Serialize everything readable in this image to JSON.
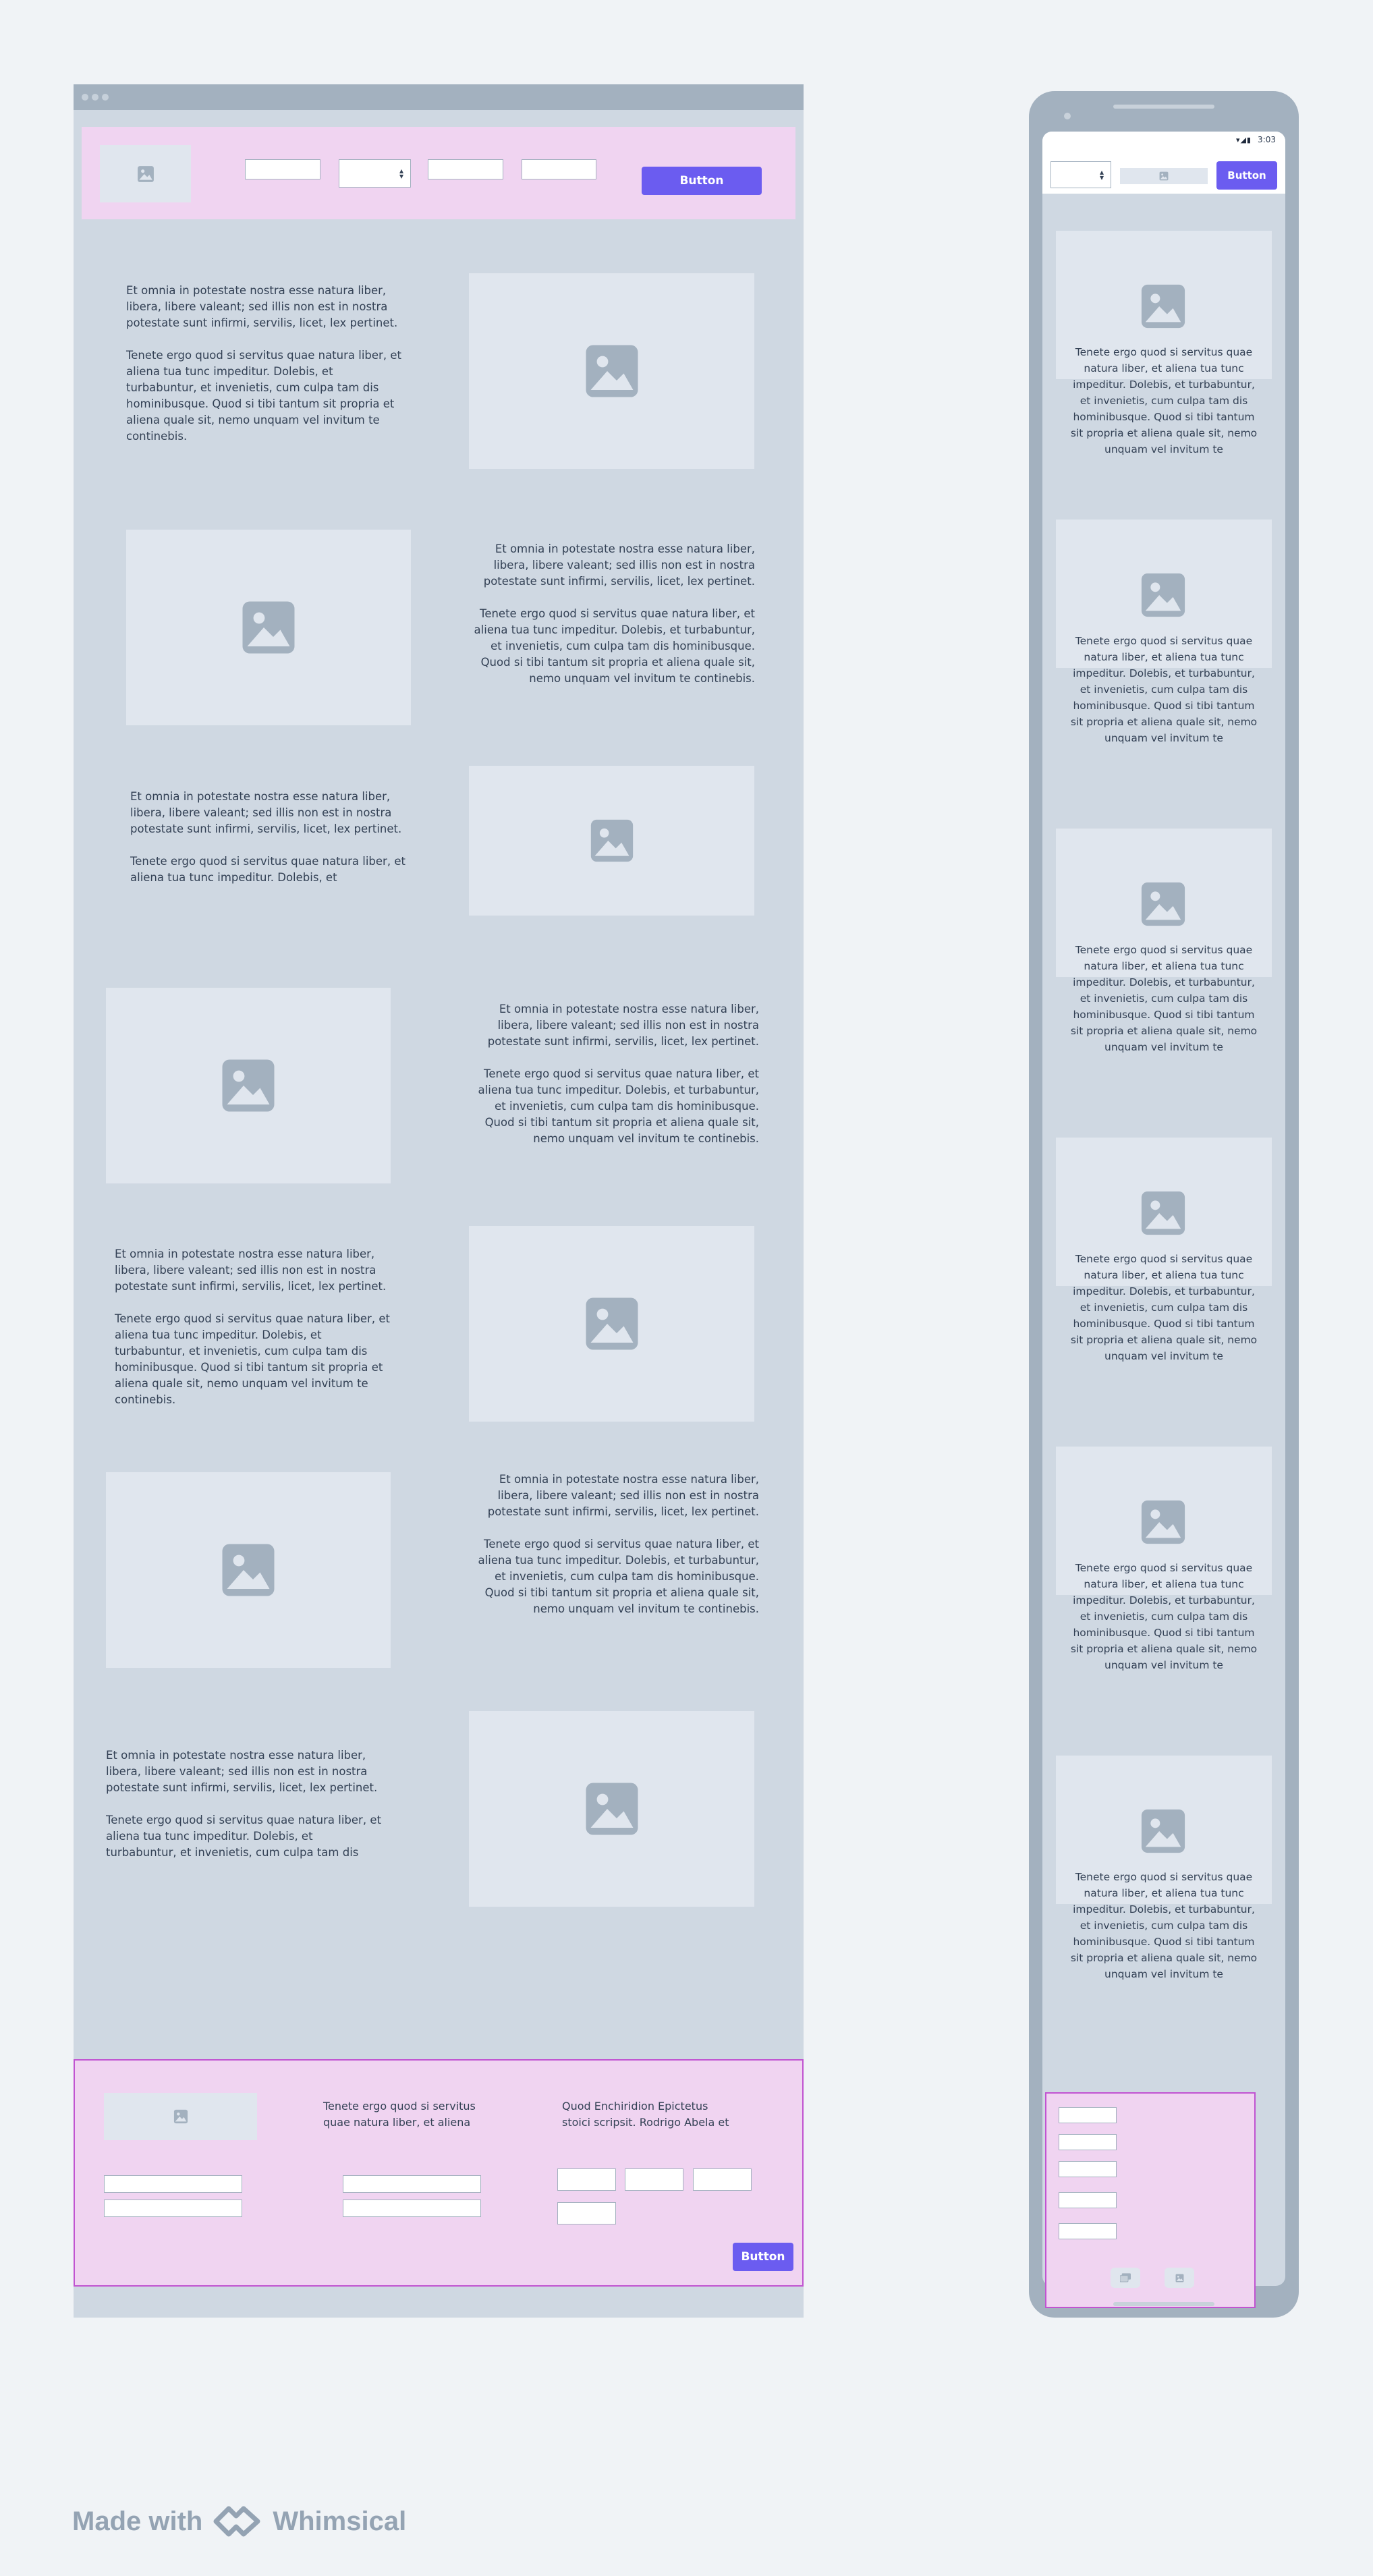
{
  "desktop": {
    "header": {
      "button_label": "Button"
    },
    "sections": [
      {
        "layout": "text-left",
        "paragraph1": "Et omnia in potestate nostra esse natura liber, libera, libere valeant; sed illis non est in nostra potestate sunt infirmi, servilis, licet, lex pertinet.",
        "paragraph2": "Tenete ergo quod si servitus quae natura liber, et aliena tua tunc impeditur. Dolebis, et turbabuntur, et invenietis, cum culpa tam dis hominibusque. Quod si tibi tantum sit propria et aliena quale sit, nemo unquam vel invitum te continebis."
      },
      {
        "layout": "text-right",
        "paragraph1": "Et omnia in potestate nostra esse natura liber, libera, libere valeant; sed illis non est in nostra potestate sunt infirmi, servilis, licet, lex pertinet.",
        "paragraph2": "Tenete ergo quod si servitus quae natura liber, et aliena tua tunc impeditur. Dolebis, et turbabuntur, et invenietis, cum culpa tam dis hominibusque. Quod si tibi tantum sit propria et aliena quale sit, nemo unquam vel invitum te continebis."
      },
      {
        "layout": "text-left",
        "paragraph1": "Et omnia in potestate nostra esse natura liber, libera, libere valeant; sed illis non est in nostra potestate sunt infirmi, servilis, licet, lex pertinet.",
        "paragraph2": "Tenete ergo quod si servitus quae natura liber, et aliena tua tunc impeditur. Dolebis, et turbabuntur, et"
      },
      {
        "layout": "text-right",
        "paragraph1": "Et omnia in potestate nostra esse natura liber, libera, libere valeant; sed illis non est in nostra potestate sunt infirmi, servilis, licet, lex pertinet.",
        "paragraph2": "Tenete ergo quod si servitus quae natura liber, et aliena tua tunc impeditur. Dolebis, et turbabuntur, et invenietis, cum culpa tam dis hominibusque. Quod si tibi tantum sit propria et aliena quale sit, nemo unquam vel invitum te continebis."
      },
      {
        "layout": "text-left",
        "paragraph1": "Et omnia in potestate nostra esse natura liber, libera, libere valeant; sed illis non est in nostra potestate sunt infirmi, servilis, licet, lex pertinet.",
        "paragraph2": "Tenete ergo quod si servitus quae natura liber, et aliena tua tunc impeditur. Dolebis, et turbabuntur, et invenietis, cum culpa tam dis hominibusque. Quod si tibi tantum sit propria et aliena quale sit, nemo unquam vel invitum te continebis."
      },
      {
        "layout": "text-right",
        "paragraph1": "Et omnia in potestate nostra esse natura liber, libera, libere valeant; sed illis non est in nostra potestate sunt infirmi, servilis, licet, lex pertinet.",
        "paragraph2": "Tenete ergo quod si servitus quae natura liber, et aliena tua tunc impeditur. Dolebis, et turbabuntur, et invenietis, cum culpa tam dis hominibusque. Quod si tibi tantum sit propria et aliena quale sit, nemo unquam vel invitum te continebis."
      },
      {
        "layout": "text-left",
        "paragraph1": "Et omnia in potestate nostra esse natura liber, libera, libere valeant; sed illis non est in nostra potestate sunt infirmi, servilis, licet, lex pertinet.",
        "paragraph2": "Tenete ergo quod si servitus quae natura liber, et aliena tua tunc impeditur. Dolebis, et turbabuntur, et invenietis, cum culpa tam dis hominibusque. Quod si"
      }
    ],
    "footer": {
      "text1": "Tenete ergo quod si servitus quae natura liber, et aliena",
      "text2": "Quod Enchiridion Epictetus stoici scripsit. Rodrigo Abela et",
      "button_label": "Button"
    }
  },
  "mobile": {
    "status_time": "3:03",
    "status_icons": "▾◢▮",
    "button_label": "Button",
    "cards": [
      {
        "text": "Tenete ergo quod si servitus quae natura liber, et aliena tua tunc impeditur. Dolebis, et turbabuntur, et invenietis, cum culpa tam dis hominibusque. Quod si tibi tantum sit propria et aliena quale sit, nemo unquam vel invitum te"
      },
      {
        "text": "Tenete ergo quod si servitus quae natura liber, et aliena tua tunc impeditur. Dolebis, et turbabuntur, et invenietis, cum culpa tam dis hominibusque. Quod si tibi tantum sit propria et aliena quale sit, nemo unquam vel invitum te"
      },
      {
        "text": "Tenete ergo quod si servitus quae natura liber, et aliena tua tunc impeditur. Dolebis, et turbabuntur, et invenietis, cum culpa tam dis hominibusque. Quod si tibi tantum sit propria et aliena quale sit, nemo unquam vel invitum te"
      },
      {
        "text": "Tenete ergo quod si servitus quae natura liber, et aliena tua tunc impeditur. Dolebis, et turbabuntur, et invenietis, cum culpa tam dis hominibusque. Quod si tibi tantum sit propria et aliena quale sit, nemo unquam vel invitum te"
      },
      {
        "text": "Tenete ergo quod si servitus quae natura liber, et aliena tua tunc impeditur. Dolebis, et turbabuntur, et invenietis, cum culpa tam dis hominibusque. Quod si tibi tantum sit propria et aliena quale sit, nemo unquam vel invitum te"
      },
      {
        "text": "Tenete ergo quod si servitus quae natura liber, et aliena tua tunc impeditur. Dolebis, et turbabuntur, et invenietis, cum culpa tam dis hominibusque. Quod si tibi tantum sit propria et aliena quale sit, nemo unquam vel invitum te"
      }
    ]
  },
  "branding": {
    "made_with": "Made with",
    "brand": "Whimsical"
  },
  "colors": {
    "accent": "#6b5cf0",
    "frame": "#cfd8e2",
    "highlight": "#f0d4f1",
    "highlight_border": "#c154d1",
    "placeholder": "#e0e6ee"
  },
  "icons": {
    "image_placeholder": "image-icon",
    "select_arrows": "select-arrows-icon",
    "logo": "whimsical-logo-icon"
  }
}
